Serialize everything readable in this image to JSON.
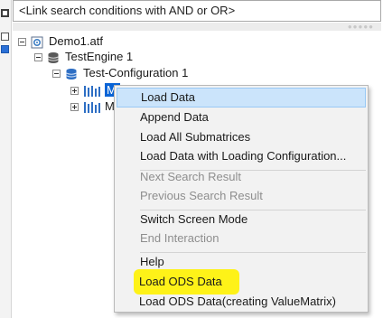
{
  "search": {
    "value": "<Link search conditions with AND or OR>"
  },
  "tree": {
    "root_label": "Demo1.atf",
    "engine_label": "TestEngine 1",
    "config_label": "Test-Configuration 1",
    "matrix1_label": "M",
    "matrix2_label": "M"
  },
  "menu": {
    "items": [
      {
        "label": "Load Data",
        "state": "highlighted"
      },
      {
        "label": "Append Data",
        "state": "enabled"
      },
      {
        "label": "Load All Submatrices",
        "state": "enabled"
      },
      {
        "label": "Load Data with Loading Configuration...",
        "state": "enabled"
      },
      {
        "label": "Next Search Result",
        "state": "disabled"
      },
      {
        "label": "Previous Search Result",
        "state": "disabled"
      },
      {
        "label": "Switch Screen Mode",
        "state": "enabled"
      },
      {
        "label": "End Interaction",
        "state": "disabled"
      },
      {
        "label": "Help",
        "state": "enabled"
      },
      {
        "label": "Load ODS Data",
        "state": "enabled"
      },
      {
        "label": "Load ODS Data(creating ValueMatrix)",
        "state": "enabled"
      }
    ]
  },
  "colors": {
    "selection": "#0a64d6",
    "menu_highlight": "#cbe4fb",
    "marker_highlight": "#fff200",
    "menu_background": "#f2f2f2"
  },
  "icons": {
    "root": "file-settings-icon",
    "engine": "database-icon",
    "config": "database-blue-icon",
    "matrix": "matrix-bars-icon"
  }
}
